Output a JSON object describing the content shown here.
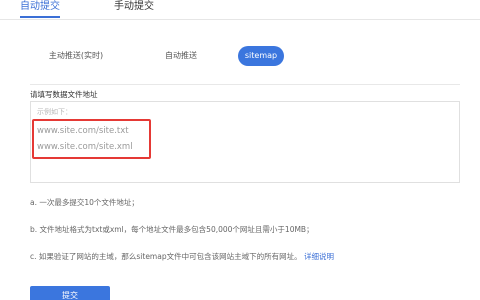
{
  "top_tabs": {
    "auto": "自动提交",
    "manual": "手动提交"
  },
  "sub_tabs": {
    "active_push": "主动推送(实时)",
    "auto_push": "自动推送",
    "sitemap": "sitemap"
  },
  "form": {
    "section_label": "请填写数据文件地址",
    "placeholder_hint": "示例如下：",
    "example_urls": [
      "www.site.com/site.txt",
      "www.site.com/site.xml"
    ]
  },
  "notes": {
    "n1": "a. 一次最多提交10个文件地址；",
    "n2": "b. 文件地址格式为txt或xml，每个地址文件最多包含50,000个网址且需小于10MB；",
    "n3": "c. 如果验证了网站的主域，那么sitemap文件中可包含该网站主域下的所有网址。",
    "n3_link": "详细说明"
  },
  "submit_label": "提交",
  "colors": {
    "accent": "#3b76de",
    "highlight_border": "#e53935"
  }
}
